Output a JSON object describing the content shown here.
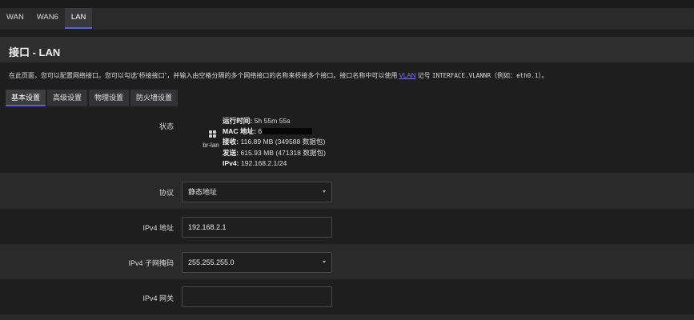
{
  "top_tabs": [
    "WAN",
    "WAN6",
    "LAN"
  ],
  "active_top_tab": "LAN",
  "page_title": "接口 - LAN",
  "description": {
    "before_link": "在此页面，您可以配置网络接口。您可以勾选“桥接接口”，并输入由空格分隔的多个网络接口的名称来桥接多个接口。接口名称中可以使用 ",
    "link": "VLAN",
    "middle": " 记号 ",
    "code1": "INTERFACE.VLANNR",
    "paren_open": "（例如：",
    "code2": "eth0.1",
    "paren_close": "）。"
  },
  "sub_tabs": [
    "基本设置",
    "高级设置",
    "物理设置",
    "防火墙设置"
  ],
  "active_sub_tab": "基本设置",
  "status": {
    "label": "状态",
    "icon": "network-bridge-icon",
    "interface_name": "br-lan",
    "uptime_label": "运行时间:",
    "uptime_value": "5h 55m 55s",
    "mac_label": "MAC 地址:",
    "mac_value": "6",
    "rx_label": "接收:",
    "rx_value": "116.89 MB (349588 数据包)",
    "tx_label": "发送:",
    "tx_value": "615.93 MB (471318 数据包)",
    "ipv4_label": "IPv4:",
    "ipv4_value": "192.168.2.1/24"
  },
  "protocol": {
    "label": "协议",
    "value": "静态地址"
  },
  "ipv4_address": {
    "label": "IPv4 地址",
    "value": "192.168.2.1"
  },
  "ipv4_netmask": {
    "label": "IPv4 子网掩码",
    "value": "255.255.255.0"
  },
  "ipv4_gateway": {
    "label": "IPv4 网关",
    "value": ""
  },
  "colors": {
    "accent": "#5a62c7",
    "link": "#7b7fd9",
    "background": "#1e1e1f"
  }
}
